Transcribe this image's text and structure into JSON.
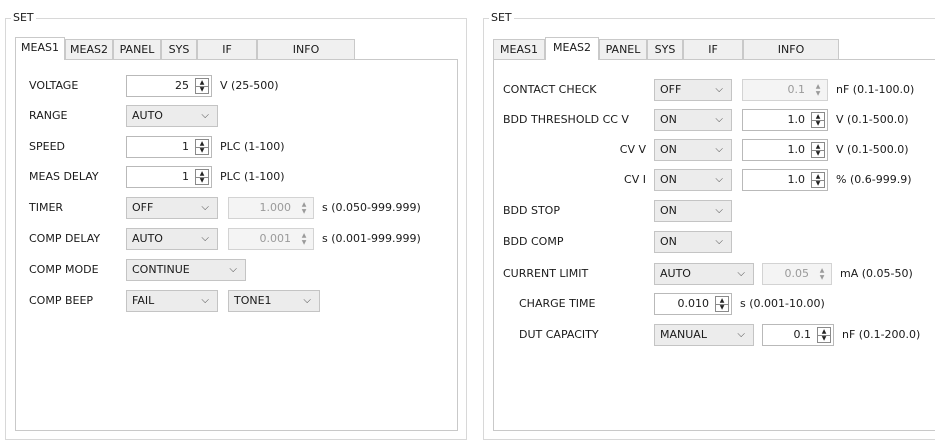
{
  "left": {
    "title": "SET",
    "tabs": [
      "MEAS1",
      "MEAS2",
      "PANEL",
      "SYS",
      "IF",
      "INFO"
    ],
    "rows": {
      "voltage": {
        "label": "VOLTAGE",
        "value": "25",
        "range": "V (25-500)"
      },
      "range": {
        "label": "RANGE",
        "value": "AUTO"
      },
      "speed": {
        "label": "SPEED",
        "value": "1",
        "range": "PLC (1-100)"
      },
      "meas_delay": {
        "label": "MEAS DELAY",
        "value": "1",
        "range": "PLC (1-100)"
      },
      "timer": {
        "label": "TIMER",
        "select": "OFF",
        "value": "1.000",
        "range": "s (0.050-999.999)"
      },
      "comp_delay": {
        "label": "COMP DELAY",
        "select": "AUTO",
        "value": "0.001",
        "range": "s (0.001-999.999)"
      },
      "comp_mode": {
        "label": "COMP MODE",
        "value": "CONTINUE"
      },
      "comp_beep": {
        "label": "COMP BEEP",
        "select": "FAIL",
        "tone": "TONE1"
      }
    }
  },
  "right": {
    "title": "SET",
    "tabs": [
      "MEAS1",
      "MEAS2",
      "PANEL",
      "SYS",
      "IF",
      "INFO"
    ],
    "rows": {
      "contact_check": {
        "label": "CONTACT CHECK",
        "select": "OFF",
        "value": "0.1",
        "range": "nF (0.1-100.0)"
      },
      "bdd_cc_v": {
        "label": "BDD THRESHOLD CC V",
        "select": "ON",
        "value": "1.0",
        "range": "V (0.1-500.0)"
      },
      "bdd_cv_v": {
        "label": "CV V",
        "select": "ON",
        "value": "1.0",
        "range": "V (0.1-500.0)"
      },
      "bdd_cv_i": {
        "label": "CV I",
        "select": "ON",
        "value": "1.0",
        "range": "% (0.6-999.9)"
      },
      "bdd_stop": {
        "label": "BDD STOP",
        "select": "ON"
      },
      "bdd_comp": {
        "label": "BDD COMP",
        "select": "ON"
      },
      "current_limit": {
        "label": "CURRENT LIMIT",
        "select": "AUTO",
        "value": "0.05",
        "range": "mA (0.05-50)"
      },
      "charge_time": {
        "label": "CHARGE TIME",
        "value": "0.010",
        "range": "s (0.001-10.00)"
      },
      "dut_capacity": {
        "label": "DUT CAPACITY",
        "select": "MANUAL",
        "value": "0.1",
        "range": "nF (0.1-200.0)"
      }
    }
  },
  "icons": {
    "spin": "spin-updown-icon",
    "chevron": "chevron-down-icon"
  }
}
